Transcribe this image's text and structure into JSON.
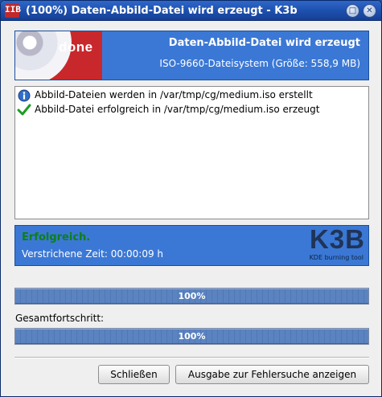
{
  "window": {
    "title": "(100%) Daten-Abbild-Datei wird erzeugt - K3b",
    "app_icon_text": "IIB"
  },
  "header": {
    "badge": "done",
    "title": "Daten-Abbild-Datei wird erzeugt",
    "subtitle": "ISO-9660-Dateisystem (Größe: 558,9 MB)"
  },
  "log": {
    "items": [
      {
        "icon": "info-icon",
        "text": "Abbild-Dateien werden in /var/tmp/cg/medium.iso erstellt"
      },
      {
        "icon": "checkmark-icon",
        "text": "Abbild-Datei erfolgreich in /var/tmp/cg/medium.iso erzeugt"
      }
    ]
  },
  "status": {
    "title": "Erfolgreich.",
    "elapsed": "Verstrichene Zeit: 00:00:09 h",
    "logo_text": "K3B",
    "logo_subtitle": "KDE burning tool"
  },
  "progress": {
    "task": {
      "label": "100%",
      "fraction": 1.0
    },
    "overall_label": "Gesamtfortschritt:",
    "overall": {
      "label": "100%",
      "fraction": 1.0
    }
  },
  "buttons": {
    "close": "Schließen",
    "debug": "Ausgabe zur Fehlersuche anzeigen"
  },
  "colors": {
    "banner": "#3b78d5",
    "success": "#0d7f16",
    "progress_fill": "#5b83c0"
  }
}
